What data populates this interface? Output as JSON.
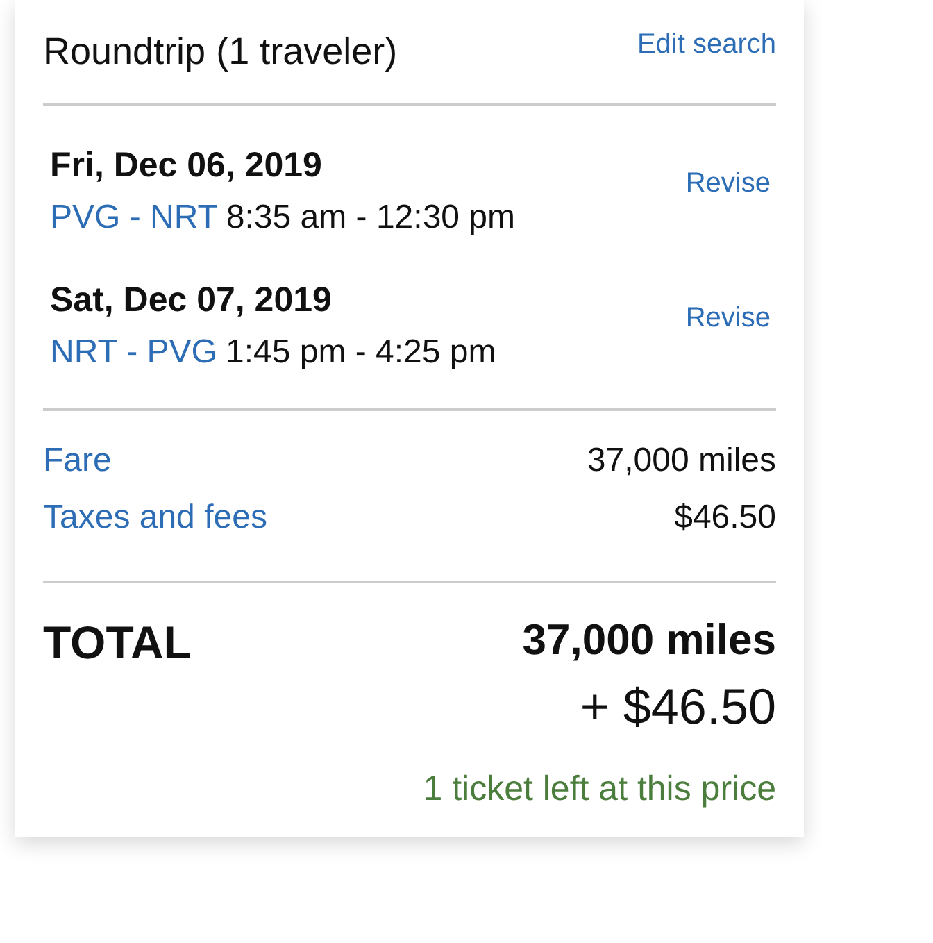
{
  "header": {
    "title": "Roundtrip (1 traveler)",
    "edit_link": "Edit search"
  },
  "flights": [
    {
      "date": "Fri, Dec 06, 2019",
      "route": "PVG - NRT",
      "times": "8:35 am - 12:30 pm",
      "action": "Revise"
    },
    {
      "date": "Sat, Dec 07, 2019",
      "route": "NRT - PVG",
      "times": "1:45 pm - 4:25 pm",
      "action": "Revise"
    }
  ],
  "price_lines": [
    {
      "label": "Fare",
      "value": "37,000 miles"
    },
    {
      "label": "Taxes and fees",
      "value": "$46.50"
    }
  ],
  "total": {
    "label": "TOTAL",
    "miles": "37,000 miles",
    "cash": "+ $46.50"
  },
  "availability_note": "1 ticket left at this price"
}
